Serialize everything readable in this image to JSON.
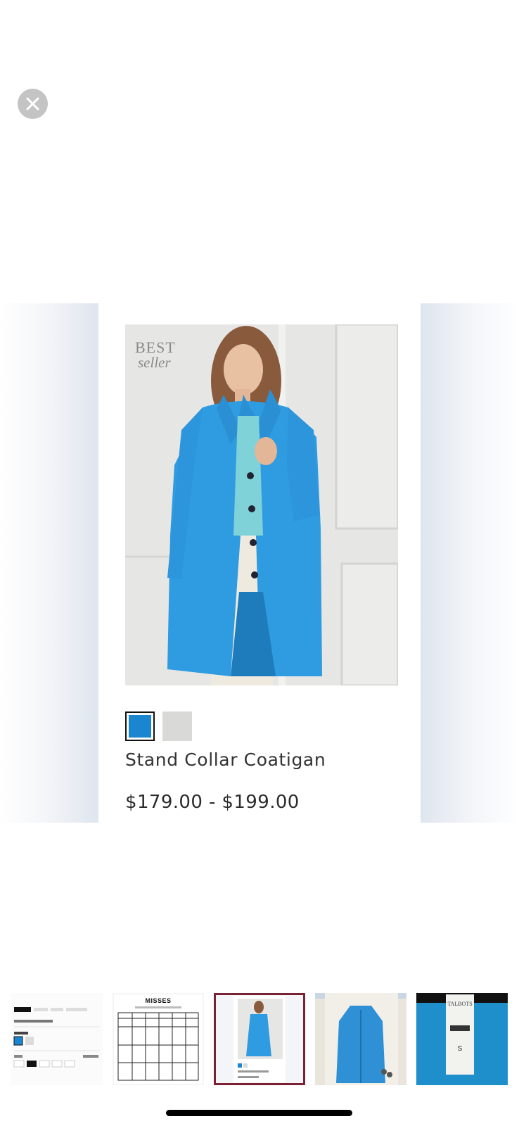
{
  "close_button": {
    "icon": "close-icon"
  },
  "product": {
    "badge_best": "BEST",
    "badge_seller": "seller",
    "name": "Stand Collar Coatigan",
    "price": "$179.00 - $199.00",
    "swatches": [
      {
        "color": "#1a86cf",
        "selected": true
      },
      {
        "color": "#d9dad8",
        "selected": false
      }
    ]
  },
  "thumbnails": {
    "size_chart_title": "MISSES",
    "tag_brand": "TALBOTS",
    "tag_size": "S",
    "active_index": 3
  },
  "colors": {
    "coat_blue": "#2f9be0",
    "active_thumb_border": "#7a2233"
  }
}
